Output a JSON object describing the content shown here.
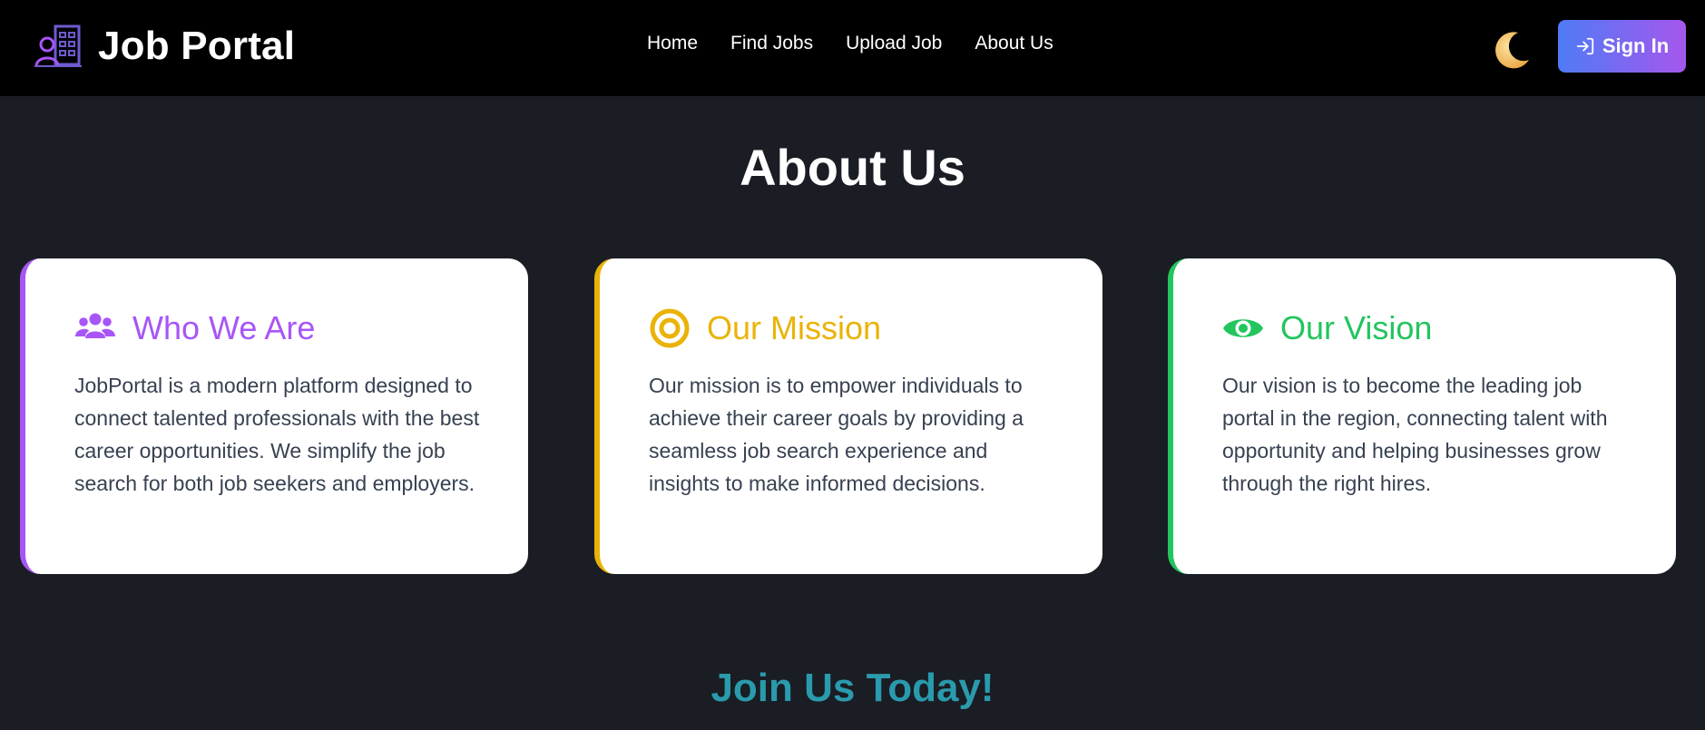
{
  "navbar": {
    "brand": "Job Portal",
    "links": [
      "Home",
      "Find Jobs",
      "Upload Job",
      "About Us"
    ],
    "theme_icon": "moon-icon",
    "signin_label": "Sign In",
    "signin_icon": "sign-in-icon",
    "signin_gradient": [
      "#4f7bf6",
      "#a557ec"
    ]
  },
  "page": {
    "title": "About Us"
  },
  "cards": [
    {
      "title": "Who We Are",
      "icon": "users-icon",
      "accent": "#a855f7",
      "body": "JobPortal is a modern platform designed to connect talented professionals with the best career opportunities. We simplify the job search for both job seekers and employers."
    },
    {
      "title": "Our Mission",
      "icon": "target-icon",
      "accent": "#eab308",
      "body": "Our mission is to empower individuals to achieve their career goals by providing a seamless job search experience and insights to make informed decisions."
    },
    {
      "title": "Our Vision",
      "icon": "eye-icon",
      "accent": "#22c55e",
      "body": "Our vision is to become the leading job portal in the region, connecting talent with opportunity and helping businesses grow through the right hires."
    }
  ],
  "join": {
    "title": "Join Us Today!"
  },
  "colors": {
    "background": "#1a1d23",
    "navbar": "#000000",
    "join_title": "#2a9aad"
  }
}
